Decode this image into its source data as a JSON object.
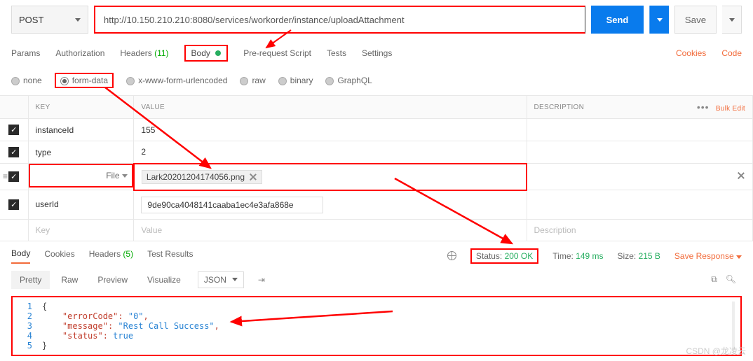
{
  "request": {
    "method": "POST",
    "url": "http://10.150.210.210:8080/services/workorder/instance/uploadAttachment",
    "send": "Send",
    "save": "Save"
  },
  "tabs": {
    "params": "Params",
    "auth": "Authorization",
    "headers_label": "Headers",
    "headers_count": "(11)",
    "body": "Body",
    "prereq": "Pre-request Script",
    "tests": "Tests",
    "settings": "Settings",
    "cookies": "Cookies",
    "code": "Code"
  },
  "body_types": {
    "none": "none",
    "form": "form-data",
    "urlenc": "x-www-form-urlencoded",
    "raw": "raw",
    "binary": "binary",
    "graphql": "GraphQL"
  },
  "table": {
    "headers": {
      "key": "KEY",
      "value": "VALUE",
      "description": "DESCRIPTION",
      "bulk": "Bulk Edit"
    },
    "rows": [
      {
        "key": "instanceId",
        "value": "155"
      },
      {
        "key": "type",
        "value": "2"
      },
      {
        "key": "",
        "file_label": "File",
        "value": "Lark20201204174056.png"
      },
      {
        "key": "userId",
        "value": "9de90ca4048141caaba1ec4e3afa868e"
      }
    ],
    "placeholder": {
      "key": "Key",
      "value": "Value",
      "description": "Description"
    }
  },
  "response": {
    "tabs": {
      "body": "Body",
      "cookies": "Cookies",
      "headers_label": "Headers",
      "headers_count": "(5)",
      "tests": "Test Results"
    },
    "status_label": "Status:",
    "status_value": "200 OK",
    "time_label": "Time:",
    "time_value": "149 ms",
    "size_label": "Size:",
    "size_value": "215 B",
    "save_response": "Save Response",
    "pretty": {
      "pretty": "Pretty",
      "raw": "Raw",
      "preview": "Preview",
      "visualize": "Visualize",
      "format": "JSON"
    },
    "json": {
      "l1": "{",
      "l2_k": "\"errorCode\"",
      "l2_v": "\"0\"",
      "l3_k": "\"message\"",
      "l3_v": "\"Rest Call Success\"",
      "l4_k": "\"status\"",
      "l4_v": "true",
      "l5": "}"
    }
  },
  "watermark": "CSDN @龙凌云"
}
